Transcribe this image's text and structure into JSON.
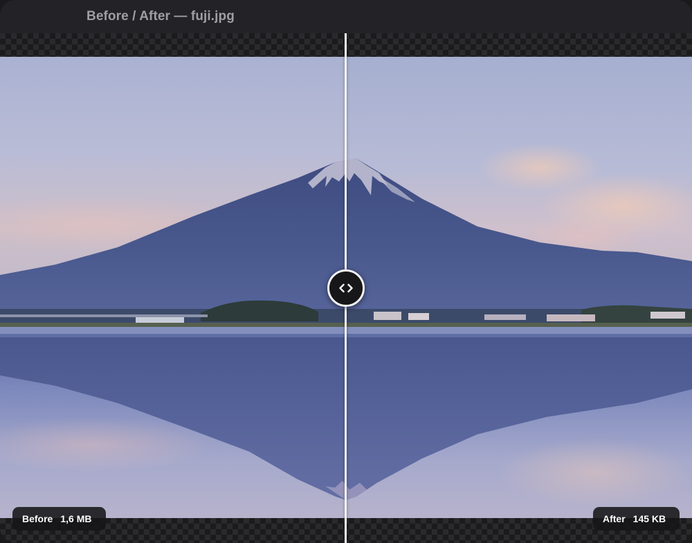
{
  "window": {
    "title": "Before / After — fuji.jpg"
  },
  "comparison": {
    "split_percent": 50,
    "before": {
      "label": "Before",
      "size": "1,6 MB"
    },
    "after": {
      "label": "After",
      "size": "145 KB"
    },
    "handle_icon": "chevron-left-right-icon"
  },
  "colors": {
    "window_bg": "#202024",
    "title_text": "#9e9ea4",
    "divider": "#f2f2f4",
    "pill_bg": "#161618"
  }
}
